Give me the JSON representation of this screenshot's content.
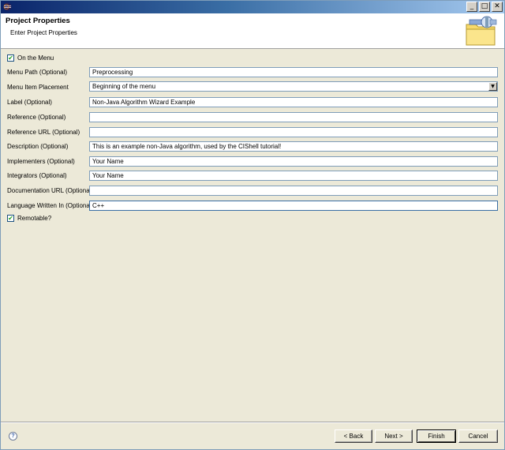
{
  "window": {
    "title": ""
  },
  "banner": {
    "title": "Project Properties",
    "subtitle": "Enter Project Properties"
  },
  "on_menu": {
    "label": "On the Menu",
    "checked": true
  },
  "fields": {
    "menu_path": {
      "label": "Menu Path (Optional)",
      "value": "Preprocessing"
    },
    "placement": {
      "label": "Menu Item Placement",
      "value": "Beginning of the menu"
    },
    "label": {
      "label": "Label (Optional)",
      "value": "Non-Java Algorithm Wizard Example"
    },
    "reference": {
      "label": "Reference (Optional)",
      "value": ""
    },
    "reference_url": {
      "label": "Reference URL (Optional)",
      "value": ""
    },
    "description": {
      "label": "Description (Optional)",
      "value": "This is an example non-Java algorithm, used by the CIShell tutorial!"
    },
    "implementers": {
      "label": "Implementers (Optional)",
      "value": "Your Name"
    },
    "integrators": {
      "label": "Integrators (Optional)",
      "value": "Your Name"
    },
    "doc_url": {
      "label": "Documentation URL (Optional)",
      "value": ""
    },
    "language": {
      "label": "Language Written In (Optional)",
      "value": "C++"
    }
  },
  "remotable": {
    "label": "Remotable?",
    "checked": true
  },
  "buttons": {
    "back": "< Back",
    "next": "Next >",
    "finish": "Finish",
    "cancel": "Cancel"
  },
  "icons": {
    "app": "eclipse-icon",
    "help": "help-icon",
    "banner": "plugin-folder-icon"
  }
}
